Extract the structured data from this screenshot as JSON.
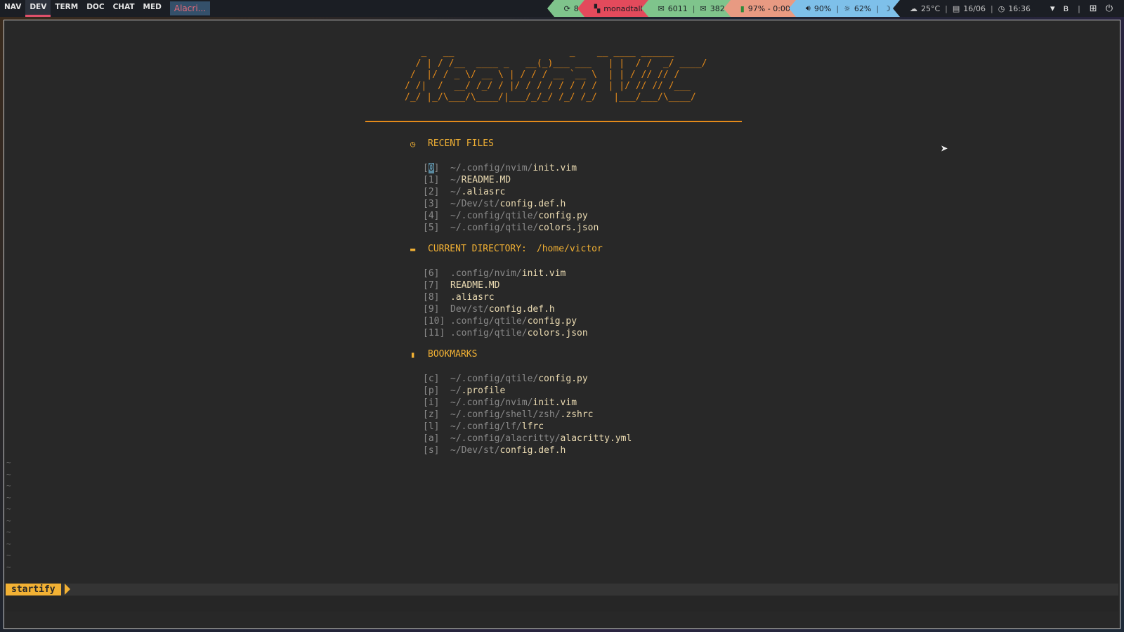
{
  "topbar": {
    "workspaces": [
      "NAV",
      "DEV",
      "TERM",
      "DOC",
      "CHAT",
      "MED"
    ],
    "active_workspace": "DEV",
    "window_title": "Alacri...",
    "updates": "8",
    "layout": "monadtall",
    "mail_a": "6011",
    "mail_b": "382",
    "battery": "97% - 0:00",
    "volume": "90%",
    "brightness": "62%",
    "weather": "25°C",
    "date": "16/06",
    "time": "16:36",
    "colors": {
      "updates": "#7fc48c",
      "layout": "#e34a5c",
      "battery": "#e89a82",
      "sys": "#7ec0ea",
      "active_underline": "#e0506a"
    }
  },
  "icons": {
    "updates": "refresh-icon",
    "layout": "layout-icon",
    "mail": "mail-icon",
    "battery": "battery-icon",
    "volume": "volume-icon",
    "brightness": "sun-icon",
    "nightmode": "moon-icon",
    "weather": "cloud-icon",
    "calendar": "calendar-icon",
    "clock": "clock-icon",
    "wifi": "wifi-icon",
    "bluetooth": "bluetooth-icon",
    "add": "plus-icon",
    "power": "power-icon"
  },
  "startify": {
    "banner": "   _   __                     _    __ ____ ______\n  / | / /__  ____ _   __(_)___ ___   | |  / /  _/ ____/\n /  |/ / _ \\/ __ \\ | / / / __ `__ \\  | | / // // /     \n/ /|  /  __/ /_/ / |/ / / / / / / /  | |/ // // /___   \n/_/ |_/\\___/\\____/|___/_/_/ /_/ /_/   |___/___/\\____/ ",
    "sections": {
      "recent": {
        "label": "RECENT FILES"
      },
      "current": {
        "label": "CURRENT DIRECTORY:",
        "dir": "/home/victor"
      },
      "bookmarks": {
        "label": "BOOKMARKS"
      }
    },
    "recent": [
      {
        "idx_open": "[",
        "idx_key": "0",
        "idx_close": "]",
        "dir": "~/.config/nvim/",
        "file": "init.vim"
      },
      {
        "idx_open": "[",
        "idx_key": "1",
        "idx_close": "]",
        "dir": "~/",
        "file": "README.MD"
      },
      {
        "idx_open": "[",
        "idx_key": "2",
        "idx_close": "]",
        "dir": "~/",
        "file": ".aliasrc"
      },
      {
        "idx_open": "[",
        "idx_key": "3",
        "idx_close": "]",
        "dir": "~/Dev/st/",
        "file": "config.def.h"
      },
      {
        "idx_open": "[",
        "idx_key": "4",
        "idx_close": "]",
        "dir": "~/.config/qtile/",
        "file": "config.py"
      },
      {
        "idx_open": "[",
        "idx_key": "5",
        "idx_close": "]",
        "dir": "~/.config/qtile/",
        "file": "colors.json"
      }
    ],
    "current": [
      {
        "idx": "[6]",
        "dir": ".config/nvim/",
        "file": "init.vim"
      },
      {
        "idx": "[7]",
        "dir": "",
        "file": "README.MD"
      },
      {
        "idx": "[8]",
        "dir": "",
        "file": ".aliasrc"
      },
      {
        "idx": "[9]",
        "dir": "Dev/st/",
        "file": "config.def.h"
      },
      {
        "idx": "[10]",
        "dir": ".config/qtile/",
        "file": "config.py"
      },
      {
        "idx": "[11]",
        "dir": ".config/qtile/",
        "file": "colors.json"
      }
    ],
    "bookmarks": [
      {
        "idx": "[c]",
        "dir": "~/.config/qtile/",
        "file": "config.py"
      },
      {
        "idx": "[p]",
        "dir": "~/",
        "file": ".profile"
      },
      {
        "idx": "[i]",
        "dir": "~/.config/nvim/",
        "file": "init.vim"
      },
      {
        "idx": "[z]",
        "dir": "~/.config/shell/zsh/",
        "file": ".zshrc"
      },
      {
        "idx": "[l]",
        "dir": "~/.config/lf/",
        "file": "lfrc"
      },
      {
        "idx": "[a]",
        "dir": "~/.config/alacritty/",
        "file": "alacritty.yml"
      },
      {
        "idx": "[s]",
        "dir": "~/Dev/st/",
        "file": "config.def.h"
      }
    ],
    "tilde": "~",
    "mode": "startify"
  }
}
